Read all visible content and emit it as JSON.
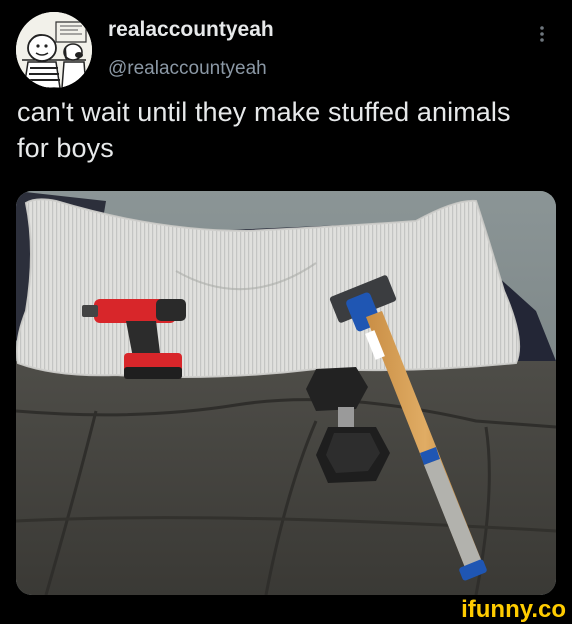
{
  "author": {
    "display_name": "realaccountyeah",
    "handle": "@realaccountyeah",
    "avatar_icon": "cartoon-avatar-icon"
  },
  "tweet": {
    "text": "can't wait until they make stuffed animals for boys"
  },
  "menu": {
    "icon": "more-vertical-icon"
  },
  "media": {
    "description_icon": "photo-of-tools-on-pillow"
  },
  "watermark": {
    "text": "ifunny.co",
    "color": "#ffcc00"
  },
  "colors": {
    "background": "#000000",
    "text_primary": "#e7e9ea",
    "text_secondary": "#8b98a5"
  }
}
